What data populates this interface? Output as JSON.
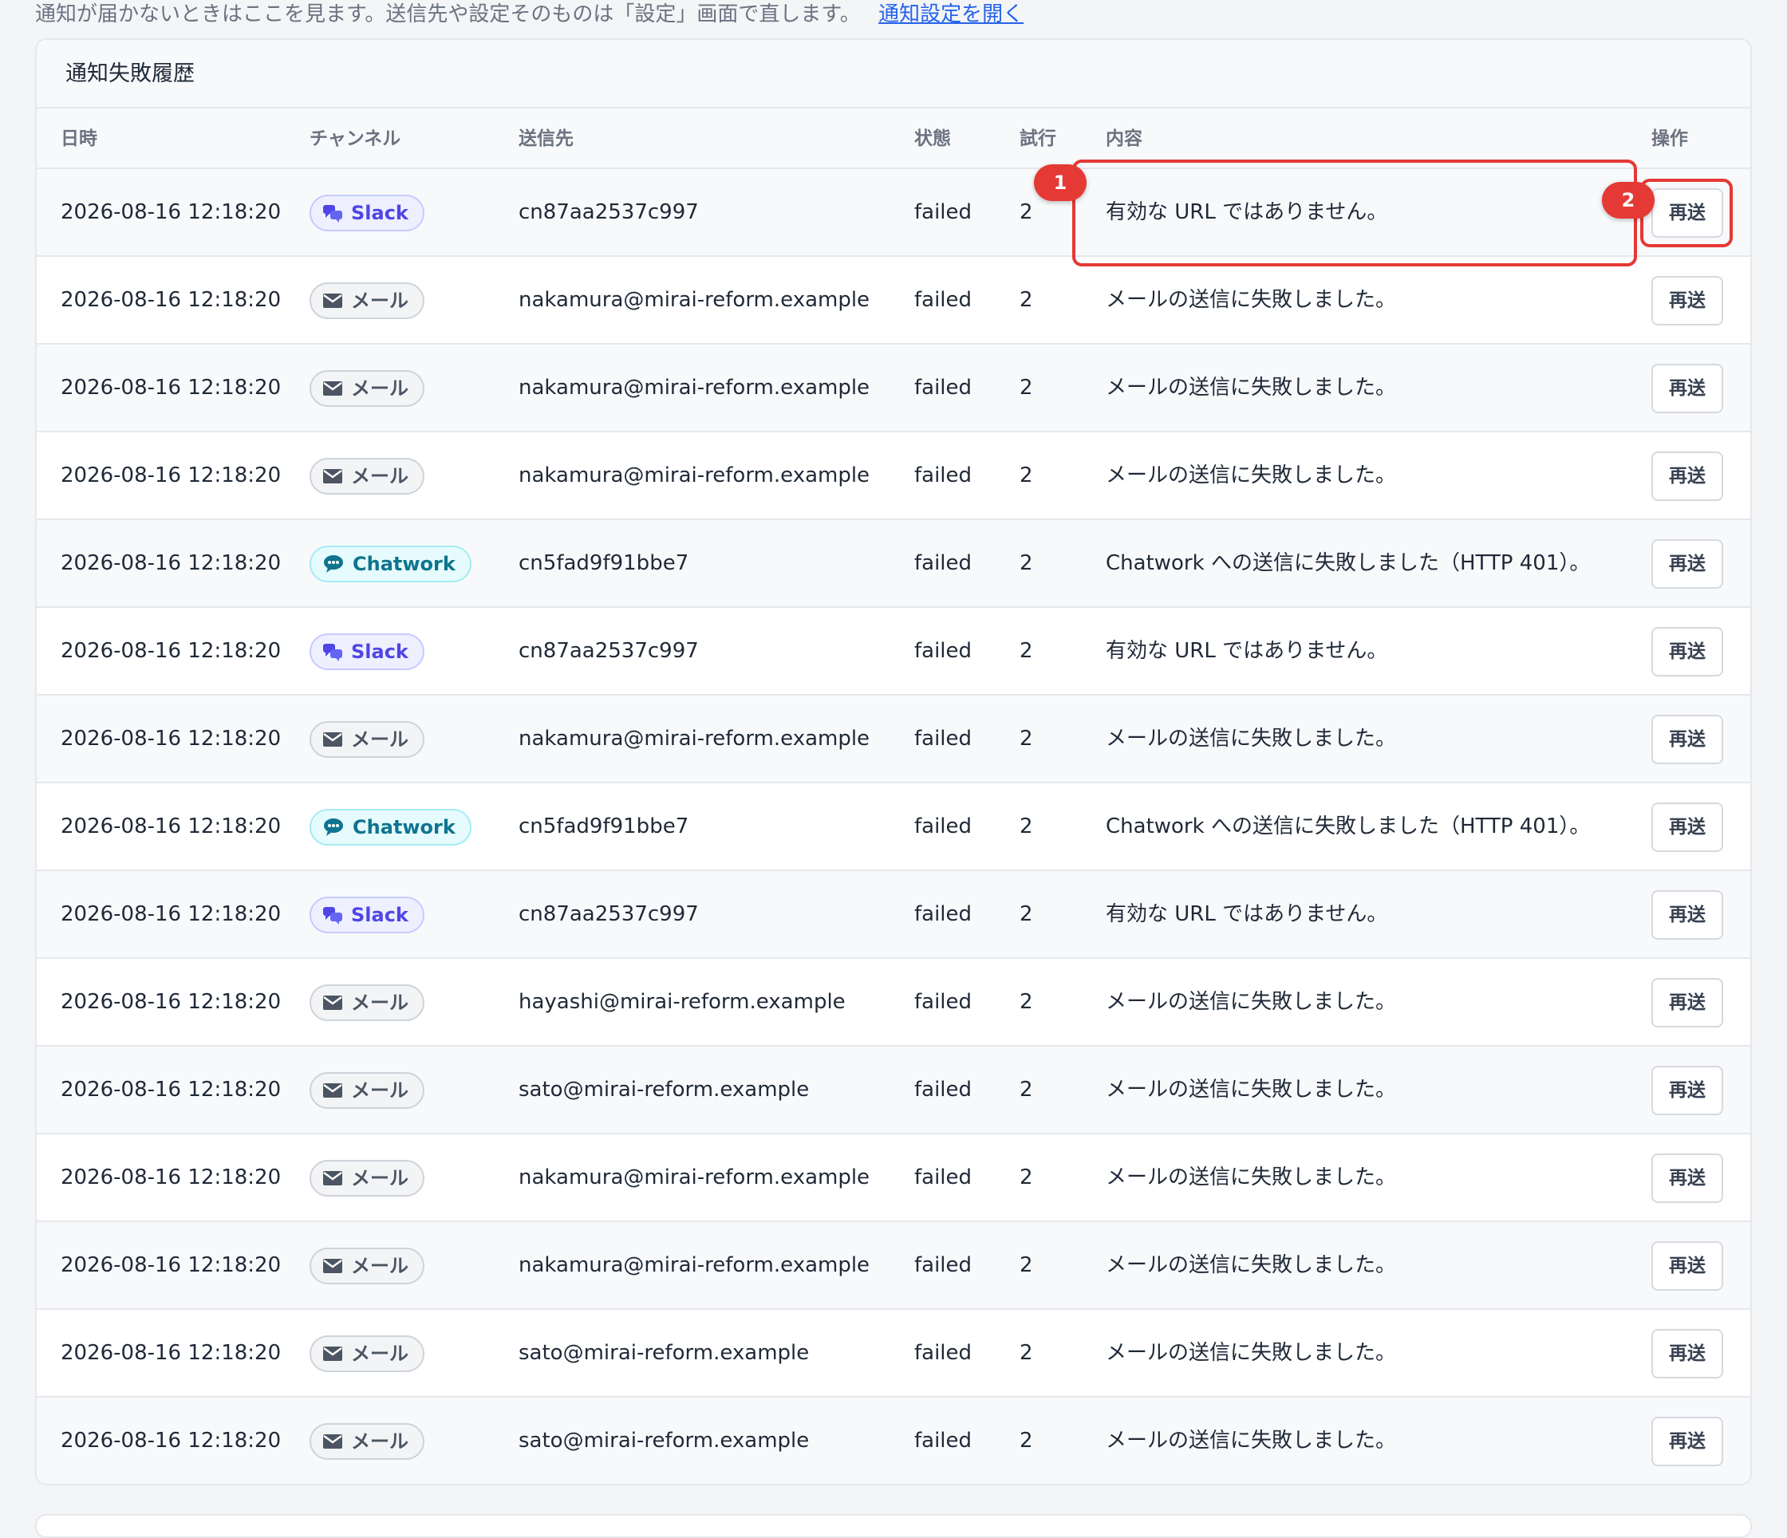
{
  "intro": {
    "text": "通知が届かないときはここを見ます。送信先や設定そのものは「設定」画面で直します。",
    "link": "通知設定を開く"
  },
  "card": {
    "title": "通知失敗履歴"
  },
  "columns": {
    "datetime": "日時",
    "channel": "チャンネル",
    "recipient": "送信先",
    "status": "状態",
    "attempts": "試行",
    "content": "内容",
    "action": "操作"
  },
  "rows": [
    {
      "datetime": "2026-08-16 12:18:20",
      "channel": "Slack",
      "channel_type": "slack",
      "recipient": "cn87aa2537c997",
      "status": "failed",
      "attempts": "2",
      "content": "有効な URL ではありません。",
      "action": "再送"
    },
    {
      "datetime": "2026-08-16 12:18:20",
      "channel": "メール",
      "channel_type": "mail",
      "recipient": "nakamura@mirai-reform.example",
      "status": "failed",
      "attempts": "2",
      "content": "メールの送信に失敗しました。",
      "action": "再送"
    },
    {
      "datetime": "2026-08-16 12:18:20",
      "channel": "メール",
      "channel_type": "mail",
      "recipient": "nakamura@mirai-reform.example",
      "status": "failed",
      "attempts": "2",
      "content": "メールの送信に失敗しました。",
      "action": "再送"
    },
    {
      "datetime": "2026-08-16 12:18:20",
      "channel": "メール",
      "channel_type": "mail",
      "recipient": "nakamura@mirai-reform.example",
      "status": "failed",
      "attempts": "2",
      "content": "メールの送信に失敗しました。",
      "action": "再送"
    },
    {
      "datetime": "2026-08-16 12:18:20",
      "channel": "Chatwork",
      "channel_type": "chatwork",
      "recipient": "cn5fad9f91bbe7",
      "status": "failed",
      "attempts": "2",
      "content": "Chatwork への送信に失敗しました（HTTP 401）。",
      "action": "再送"
    },
    {
      "datetime": "2026-08-16 12:18:20",
      "channel": "Slack",
      "channel_type": "slack",
      "recipient": "cn87aa2537c997",
      "status": "failed",
      "attempts": "2",
      "content": "有効な URL ではありません。",
      "action": "再送"
    },
    {
      "datetime": "2026-08-16 12:18:20",
      "channel": "メール",
      "channel_type": "mail",
      "recipient": "nakamura@mirai-reform.example",
      "status": "failed",
      "attempts": "2",
      "content": "メールの送信に失敗しました。",
      "action": "再送"
    },
    {
      "datetime": "2026-08-16 12:18:20",
      "channel": "Chatwork",
      "channel_type": "chatwork",
      "recipient": "cn5fad9f91bbe7",
      "status": "failed",
      "attempts": "2",
      "content": "Chatwork への送信に失敗しました（HTTP 401）。",
      "action": "再送"
    },
    {
      "datetime": "2026-08-16 12:18:20",
      "channel": "Slack",
      "channel_type": "slack",
      "recipient": "cn87aa2537c997",
      "status": "failed",
      "attempts": "2",
      "content": "有効な URL ではありません。",
      "action": "再送"
    },
    {
      "datetime": "2026-08-16 12:18:20",
      "channel": "メール",
      "channel_type": "mail",
      "recipient": "hayashi@mirai-reform.example",
      "status": "failed",
      "attempts": "2",
      "content": "メールの送信に失敗しました。",
      "action": "再送"
    },
    {
      "datetime": "2026-08-16 12:18:20",
      "channel": "メール",
      "channel_type": "mail",
      "recipient": "sato@mirai-reform.example",
      "status": "failed",
      "attempts": "2",
      "content": "メールの送信に失敗しました。",
      "action": "再送"
    },
    {
      "datetime": "2026-08-16 12:18:20",
      "channel": "メール",
      "channel_type": "mail",
      "recipient": "nakamura@mirai-reform.example",
      "status": "failed",
      "attempts": "2",
      "content": "メールの送信に失敗しました。",
      "action": "再送"
    },
    {
      "datetime": "2026-08-16 12:18:20",
      "channel": "メール",
      "channel_type": "mail",
      "recipient": "nakamura@mirai-reform.example",
      "status": "failed",
      "attempts": "2",
      "content": "メールの送信に失敗しました。",
      "action": "再送"
    },
    {
      "datetime": "2026-08-16 12:18:20",
      "channel": "メール",
      "channel_type": "mail",
      "recipient": "sato@mirai-reform.example",
      "status": "failed",
      "attempts": "2",
      "content": "メールの送信に失敗しました。",
      "action": "再送"
    },
    {
      "datetime": "2026-08-16 12:18:20",
      "channel": "メール",
      "channel_type": "mail",
      "recipient": "sato@mirai-reform.example",
      "status": "failed",
      "attempts": "2",
      "content": "メールの送信に失敗しました。",
      "action": "再送"
    }
  ],
  "annotations": [
    {
      "label": "1"
    },
    {
      "label": "2"
    }
  ],
  "icons": {
    "slack": "slack-icon",
    "mail": "mail-icon",
    "chatwork": "chatwork-icon"
  },
  "colors": {
    "highlight": "#e53935",
    "link": "#2563eb",
    "slack": "#4f46e5",
    "chatwork": "#0e7490"
  }
}
